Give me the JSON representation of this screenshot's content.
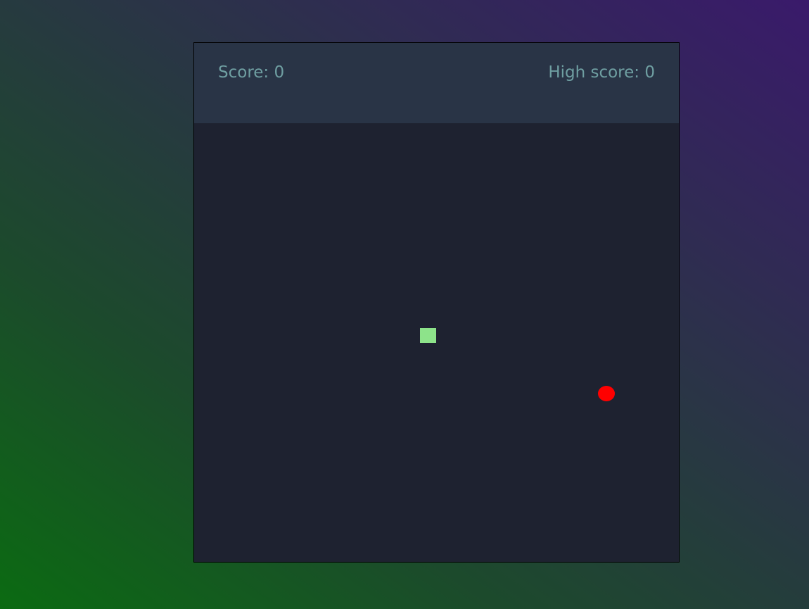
{
  "scoreboard": {
    "score_label": "Score:",
    "score_value": "0",
    "high_score_label": "High score:",
    "high_score_value": "0"
  },
  "colors": {
    "snake": "#8de38a",
    "food": "#ff0000",
    "board": "#1e2230",
    "scorebar": "#293446",
    "score_text": "#6f9fa2"
  }
}
